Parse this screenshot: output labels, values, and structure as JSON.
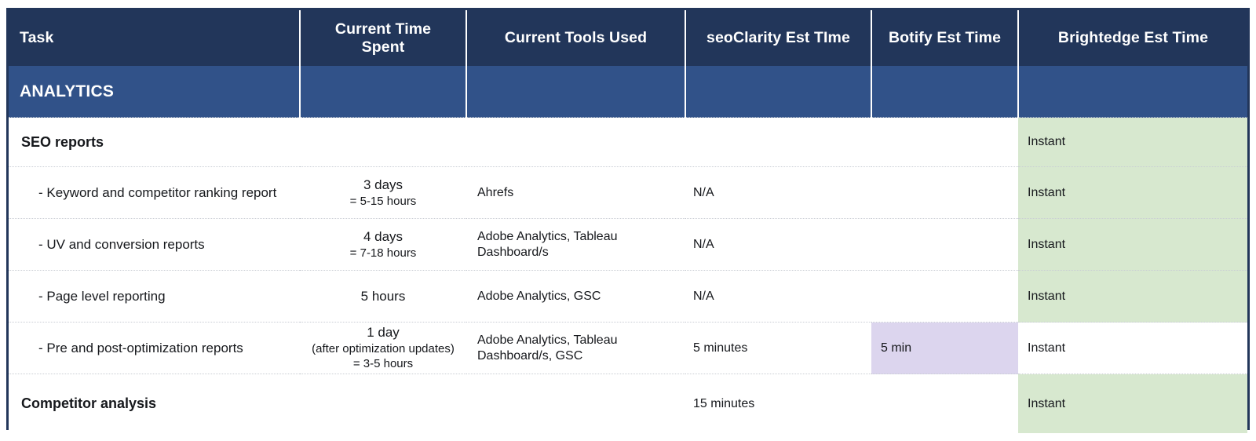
{
  "table": {
    "columns": [
      {
        "key": "task",
        "label": "Task",
        "align": "left"
      },
      {
        "key": "time",
        "label": "Current Time Spent",
        "align": "center"
      },
      {
        "key": "tools",
        "label": "Current Tools Used",
        "align": "center"
      },
      {
        "key": "seo",
        "label": "seoClarity Est TIme",
        "align": "center"
      },
      {
        "key": "botify",
        "label": "Botify Est Time",
        "align": "center"
      },
      {
        "key": "bedge",
        "label": "Brightedge Est Time",
        "align": "center"
      }
    ],
    "section": {
      "label": "ANALYTICS"
    },
    "rows": [
      {
        "task": "SEO reports",
        "time_main": "",
        "time_note": "",
        "time_sub": "",
        "tools": "",
        "seo": "",
        "botify": "",
        "bedge": "Instant"
      },
      {
        "task": "- Keyword and competitor ranking report",
        "time_main": "3 days",
        "time_note": "",
        "time_sub": "= 5-15 hours",
        "tools": "Ahrefs",
        "seo": "N/A",
        "botify": "",
        "bedge": "Instant"
      },
      {
        "task": "- UV and conversion reports",
        "time_main": "4 days",
        "time_note": "",
        "time_sub": "= 7-18 hours",
        "tools": "Adobe Analytics, Tableau Dashboard/s",
        "seo": "N/A",
        "botify": "",
        "bedge": "Instant"
      },
      {
        "task": "- Page level reporting",
        "time_main": "5 hours",
        "time_note": "",
        "time_sub": "",
        "tools": "Adobe Analytics, GSC",
        "seo": "N/A",
        "botify": "",
        "bedge": "Instant"
      },
      {
        "task": "- Pre and post-optimization reports",
        "time_main": "1 day",
        "time_note": "(after optimization updates)",
        "time_sub": "= 3-5 hours",
        "tools": "Adobe Analytics, Tableau Dashboard/s, GSC",
        "seo": "5 minutes",
        "botify": "5 min",
        "bedge": "Instant"
      },
      {
        "task": "Competitor analysis",
        "time_main": "",
        "time_note": "",
        "time_sub": "",
        "tools": "",
        "seo": "15 minutes",
        "botify": "",
        "bedge": "Instant"
      }
    ]
  },
  "colors": {
    "header_bg": "#22365a",
    "section_bg": "#315289",
    "highlight_green": "#d7e8cf",
    "highlight_purple": "#dcd5ee",
    "border": "#22365a",
    "text": "#16181c"
  }
}
